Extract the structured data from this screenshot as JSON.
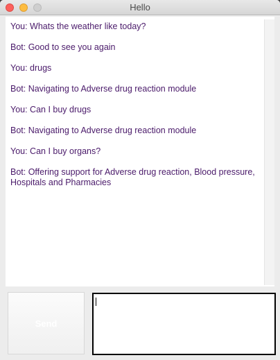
{
  "window": {
    "title": "Hello"
  },
  "chat": {
    "messages": [
      "You: Whats the weather like today?",
      "Bot: Good to see you again",
      "You: drugs",
      "Bot: Navigating to Adverse drug reaction module",
      "You: Can I buy drugs",
      "Bot: Navigating to Adverse drug reaction module",
      "You: Can I buy organs?",
      "Bot: Offering support for Adverse drug reaction, Blood pressure, Hospitals and Pharmacies"
    ]
  },
  "composer": {
    "send_label": "Send",
    "input_value": ""
  },
  "colors": {
    "message_text": "#4a1a6a",
    "close": "#fc605c",
    "minimize": "#fdbc40",
    "maximize_inactive": "#cfcfcf"
  }
}
